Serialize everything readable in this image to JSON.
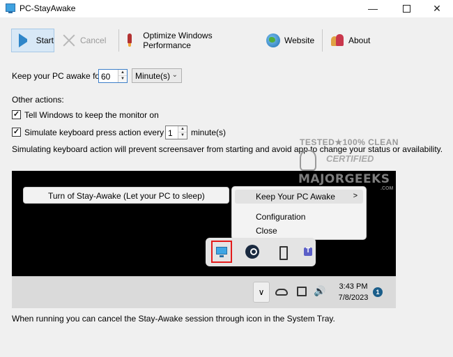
{
  "window": {
    "title": "PC-StayAwake",
    "minimize_glyph": "—",
    "close_glyph": "✕"
  },
  "toolbar": {
    "start_label": "Start",
    "cancel_label": "Cancel",
    "optimize_label": "Optimize Windows Performance",
    "website_label": "Website",
    "about_label": "About"
  },
  "settings": {
    "keep_awake_label": "Keep your PC awake for",
    "keep_awake_value": "60",
    "unit_value": "Minute(s)",
    "other_actions_label": "Other actions:",
    "monitor_label": "Tell Windows to keep the monitor on",
    "monitor_checked": true,
    "keyboard_label": "Simulate keyboard press action every",
    "keyboard_checked": true,
    "keyboard_interval": "1",
    "keyboard_unit": "minute(s)",
    "info_text": "Simulating keyboard action will prevent screensaver from starting and avoid app to change your status or availability.",
    "footer_text": "When running you can cancel the Stay-Awake session through icon in the System Tray."
  },
  "screenshot": {
    "menu_left_item": "Turn of Stay-Awake (Let your PC to sleep)",
    "menu_items": [
      "Keep Your PC Awake",
      "Configuration",
      "Close"
    ],
    "submenu_arrow": ">",
    "taskbar_chevron": "∨",
    "volume_glyph": "🔊",
    "clock_time": "3:43 PM",
    "clock_date": "7/8/2023",
    "notification_count": "1"
  },
  "watermark": {
    "top_text": "TESTED★100% CLEAN",
    "certified_text": "CERTIFIED",
    "brand_text": "MAJORGEEKS",
    "domain_text": ".COM"
  },
  "icons": {
    "start": "play-icon",
    "cancel": "x-icon",
    "optimize": "rocket-icon",
    "website": "globe-icon",
    "about": "people-icon"
  },
  "colors": {
    "accent": "#2f86c9",
    "highlight_border": "#e31b1b",
    "start_button_bg": "#d8e8f6"
  }
}
